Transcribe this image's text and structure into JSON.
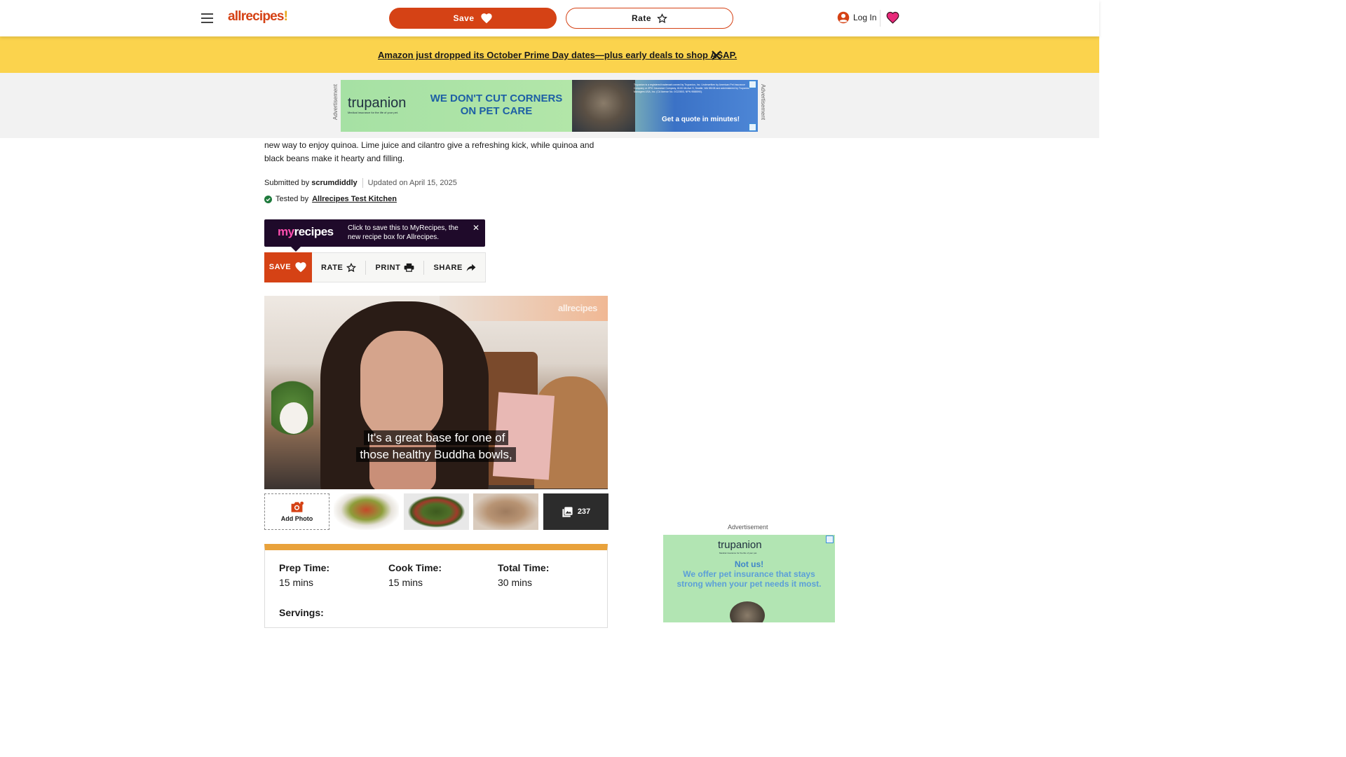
{
  "nav": {
    "logo_text": "allrecipes",
    "logo_bang": "!",
    "save_label": "Save",
    "rate_label": "Rate",
    "login_label": "Log In",
    "brand_color": "#d54215"
  },
  "promo": {
    "text": "Amazon just dropped its October Prime Day dates—plus early deals to shop ASAP.",
    "background": "#fbd34d"
  },
  "top_ad": {
    "label": "Advertisement",
    "logo": "trupanion",
    "logo_sub": "Medical insurance for the life of your pet.",
    "headline": "WE DON'T CUT CORNERS ON PET CARE",
    "fine_print": "Trupanion is a registered trademark owned by Trupanion, Inc. Underwritten by American Pet Insurance Company or ZPIC Insurance Company, 6100 4th Ave S, Seattle, WA 98108 and administered by Trupanion Managers USA, Inc. (CA license No. 0G22803, NPN 9588590).",
    "cta": "Get a quote in minutes!"
  },
  "article": {
    "intro": "new way to enjoy quinoa. Lime juice and cilantro give a refreshing kick, while quinoa and black beans make it hearty and filling.",
    "submitted_prefix": "Submitted by",
    "author": "scrumdiddly",
    "updated": "Updated on April 15, 2025",
    "tested_prefix": "Tested by",
    "tested_by": "Allrecipes Test Kitchen"
  },
  "myrecipes": {
    "logo_my": "my",
    "logo_recipes": "recipes",
    "message": "Click to save this to MyRecipes, the new recipe box for Allrecipes."
  },
  "actions": {
    "save": "SAVE",
    "rate": "RATE",
    "print": "PRINT",
    "share": "SHARE"
  },
  "video": {
    "watermark": "allrecipes",
    "caption_line1": "It's a great base for one of",
    "caption_line2": "those healthy Buddha bowls,"
  },
  "gallery": {
    "add_photo": "Add Photo",
    "photo_count": "237"
  },
  "details": {
    "prep_label": "Prep Time:",
    "prep_value": "15 mins",
    "cook_label": "Cook Time:",
    "cook_value": "15 mins",
    "total_label": "Total Time:",
    "total_value": "30 mins",
    "servings_label": "Servings:",
    "accent": "#e9a23b"
  },
  "right_ad": {
    "label": "Advertisement",
    "logo": "trupanion",
    "logo_sub": "Medical insurance for the life of your pet.",
    "line1": "Not us!",
    "line2": "We offer pet insurance that stays strong when your pet needs it most."
  }
}
